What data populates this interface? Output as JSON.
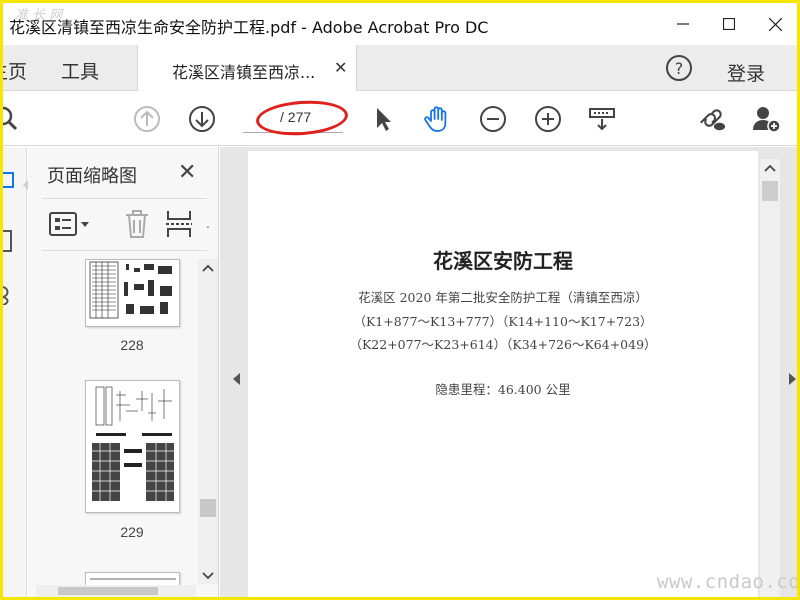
{
  "window": {
    "title": "花溪区清镇至西凉生命安全防护工程.pdf - Adobe Acrobat Pro DC",
    "watermark_top": "准 长 网"
  },
  "tabs": {
    "home": "主页",
    "tools": "工具",
    "document": "花溪区清镇至西凉...",
    "login": "登录"
  },
  "toolbar": {
    "page_total": "/ 277"
  },
  "thumbnail_panel": {
    "title": "页面缩略图",
    "pages": [
      {
        "label": "228"
      },
      {
        "label": "229"
      }
    ]
  },
  "document": {
    "title": "花溪区安防工程",
    "line1": "花溪区 2020 年第二批安全防护工程（清镇至西凉）",
    "line2": "（K1+877～K13+777）（K14+110～K17+723）",
    "line3": "（K22+077～K23+614）（K34+726～K64+049）",
    "line4": "隐患里程：46.400 公里"
  },
  "watermark": "www.cndao.com",
  "colors": {
    "annotation_circle": "#e0201c",
    "hand_tool_active": "#1473e6",
    "frame_border": "#f5e600"
  },
  "icons": [
    "minimize-icon",
    "maximize-icon",
    "close-icon",
    "search-icon",
    "prev-page-icon",
    "next-page-icon",
    "select-cursor-icon",
    "hand-tool-icon",
    "zoom-out-icon",
    "zoom-in-icon",
    "scroll-mode-icon",
    "share-link-icon",
    "add-user-icon",
    "help-icon",
    "thumbnail-options-icon",
    "delete-icon",
    "extract-icon"
  ]
}
